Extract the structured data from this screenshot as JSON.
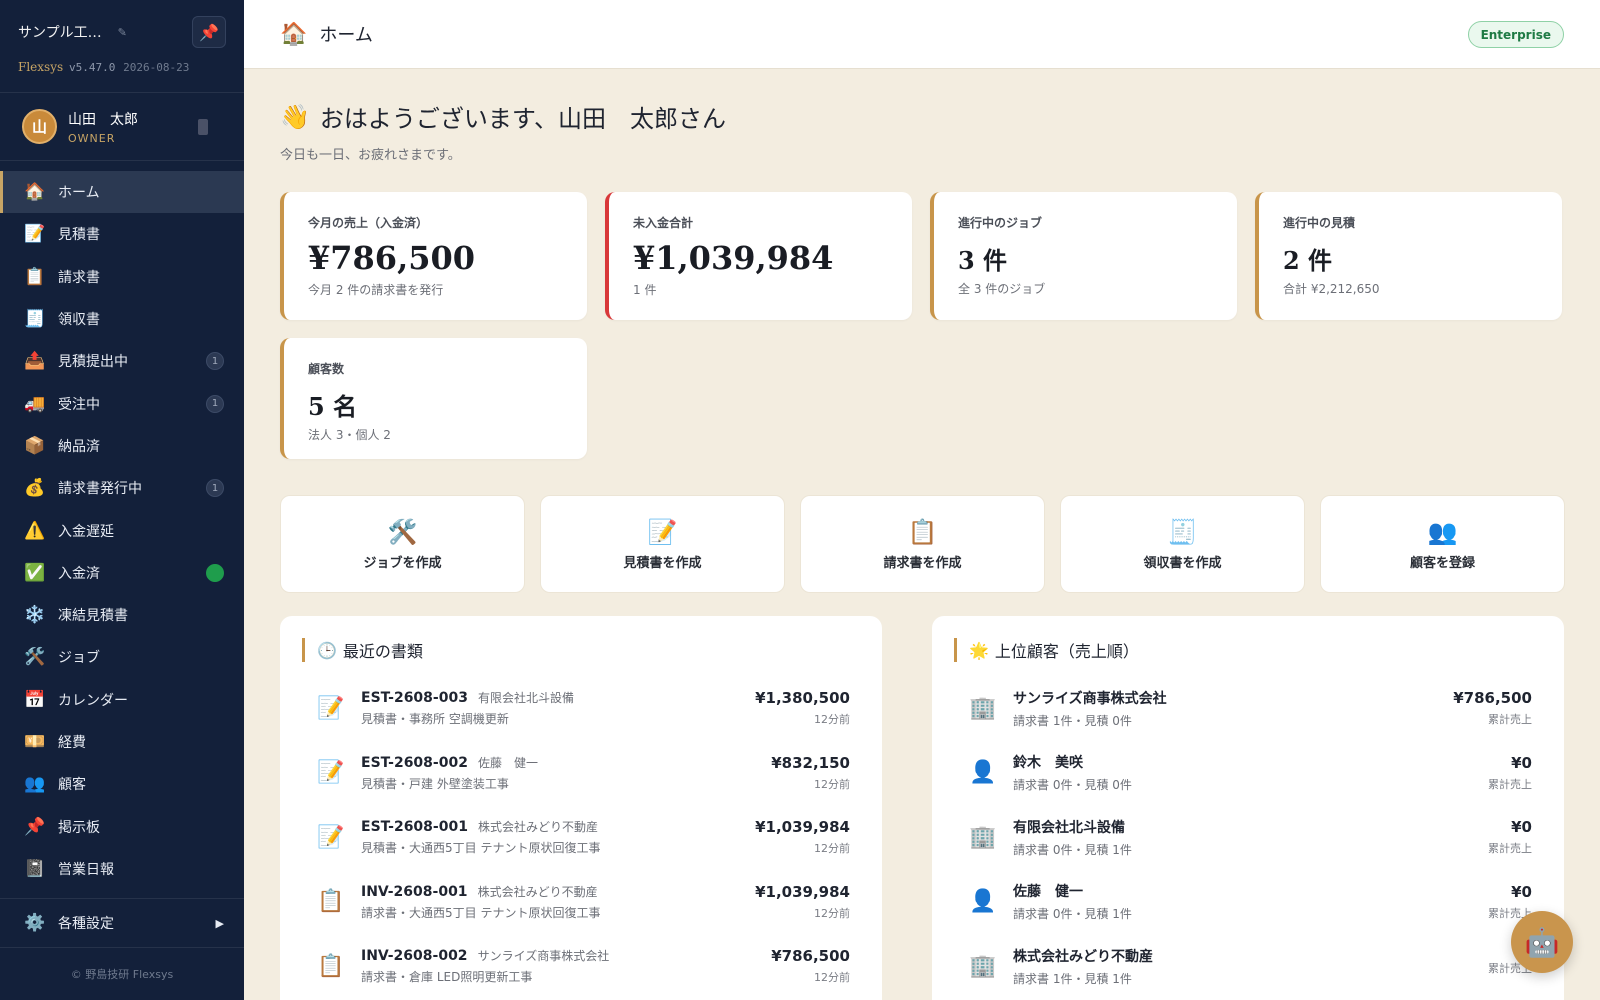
{
  "sidebar": {
    "company": "サンプル工…",
    "edit_icon": "✎",
    "pin_icon": "📌",
    "brand": "Flexsys",
    "version": "v5.47.0",
    "build_date": "2026-08-23",
    "user": {
      "initial": "山",
      "name": "山田　太郎",
      "role": "OWNER"
    },
    "nav": [
      {
        "icon": "🏠",
        "label": "ホーム",
        "active": true
      },
      {
        "icon": "📝",
        "label": "見積書"
      },
      {
        "icon": "📋",
        "label": "請求書"
      },
      {
        "icon": "🧾",
        "label": "領収書"
      },
      {
        "icon": "📤",
        "label": "見積提出中",
        "badge": "1"
      },
      {
        "icon": "🚚",
        "label": "受注中",
        "badge": "1"
      },
      {
        "icon": "📦",
        "label": "納品済"
      },
      {
        "icon": "💰",
        "label": "請求書発行中",
        "badge": "1"
      },
      {
        "icon": "⚠️",
        "label": "入金遅延"
      },
      {
        "icon": "✅",
        "label": "入金済",
        "badge": "",
        "badge_color": "green"
      },
      {
        "icon": "❄️",
        "label": "凍結見積書"
      },
      {
        "icon": "🛠️",
        "label": "ジョブ"
      },
      {
        "icon": "📅",
        "label": "カレンダー"
      },
      {
        "icon": "💴",
        "label": "経費"
      },
      {
        "icon": "👥",
        "label": "顧客"
      },
      {
        "icon": "📌",
        "label": "掲示板"
      },
      {
        "icon": "📓",
        "label": "営業日報"
      }
    ],
    "settings": {
      "icon": "⚙️",
      "label": "各種設定",
      "arrow": "▶"
    },
    "footer": "© 野島技研 Flexsys"
  },
  "header": {
    "icon": "🏠",
    "title": "ホーム",
    "plan": "Enterprise"
  },
  "greeting": {
    "wave": "👋",
    "text": "おはようございます、山田　太郎さん",
    "sub": "今日も一日、お疲れさまです。"
  },
  "stats": [
    {
      "label": "今月の売上（入金済）",
      "value": "¥786,500",
      "sub": "今月 2 件の請求書を発行",
      "accent": "gold"
    },
    {
      "label": "未入金合計",
      "value": "¥1,039,984",
      "sub": "1 件",
      "accent": "red"
    },
    {
      "label": "進行中のジョブ",
      "value": "3 件",
      "sub": "全 3 件のジョブ",
      "accent": "gold"
    },
    {
      "label": "進行中の見積",
      "value": "2 件",
      "sub": "合計 ¥2,212,650",
      "accent": "gold"
    },
    {
      "label": "顧客数",
      "value": "5 名",
      "sub": "法人 3・個人 2",
      "accent": "gold"
    }
  ],
  "actions": [
    {
      "icon": "🛠️",
      "label": "ジョブを作成"
    },
    {
      "icon": "📝",
      "label": "見積書を作成"
    },
    {
      "icon": "📋",
      "label": "請求書を作成"
    },
    {
      "icon": "🧾",
      "label": "領収書を作成"
    },
    {
      "icon": "👥",
      "label": "顧客を登録"
    }
  ],
  "recent": {
    "icon": "🕒",
    "title": "最近の書類",
    "items": [
      {
        "icon": "📝",
        "number": "EST-2608-003",
        "customer": "有限会社北斗設備",
        "desc": "見積書・事務所 空調機更新",
        "amount": "¥1,380,500",
        "time": "12分前"
      },
      {
        "icon": "📝",
        "number": "EST-2608-002",
        "customer": "佐藤　健一",
        "desc": "見積書・戸建 外壁塗装工事",
        "amount": "¥832,150",
        "time": "12分前"
      },
      {
        "icon": "📝",
        "number": "EST-2608-001",
        "customer": "株式会社みどり不動産",
        "desc": "見積書・大通西5丁目 テナント原状回復工事",
        "amount": "¥1,039,984",
        "time": "12分前"
      },
      {
        "icon": "📋",
        "number": "INV-2608-001",
        "customer": "株式会社みどり不動産",
        "desc": "請求書・大通西5丁目 テナント原状回復工事",
        "amount": "¥1,039,984",
        "time": "12分前"
      },
      {
        "icon": "📋",
        "number": "INV-2608-002",
        "customer": "サンライズ商事株式会社",
        "desc": "請求書・倉庫 LED照明更新工事",
        "amount": "¥786,500",
        "time": "12分前"
      }
    ]
  },
  "top_customers": {
    "icon": "🌟",
    "title": "上位顧客（売上順）",
    "items": [
      {
        "icon": "🏢",
        "name": "サンライズ商事株式会社",
        "detail": "請求書 1件・見積 0件",
        "amount": "¥786,500",
        "caption": "累計売上"
      },
      {
        "icon": "👤",
        "name": "鈴木　美咲",
        "detail": "請求書 0件・見積 0件",
        "amount": "¥0",
        "caption": "累計売上"
      },
      {
        "icon": "🏢",
        "name": "有限会社北斗設備",
        "detail": "請求書 0件・見積 1件",
        "amount": "¥0",
        "caption": "累計売上"
      },
      {
        "icon": "👤",
        "name": "佐藤　健一",
        "detail": "請求書 0件・見積 1件",
        "amount": "¥0",
        "caption": "累計売上"
      },
      {
        "icon": "🏢",
        "name": "株式会社みどり不動産",
        "detail": "請求書 1件・見積 1件",
        "amount": "",
        "caption": "累計売上"
      }
    ]
  },
  "assistant_icon": "🤖"
}
